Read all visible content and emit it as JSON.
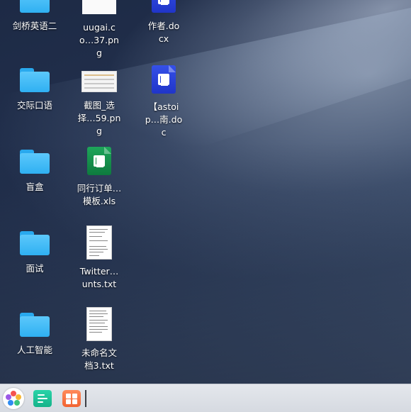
{
  "desktop": {
    "icons": [
      {
        "label": "剑桥英语二",
        "type": "folder"
      },
      {
        "label": "uugai.co…37.png",
        "type": "image"
      },
      {
        "label": "作者.docx",
        "type": "word"
      },
      {
        "label": "交际口语",
        "type": "folder"
      },
      {
        "label": "截图_选择…59.png",
        "type": "image"
      },
      {
        "label": "【astoip…南.doc",
        "type": "word"
      },
      {
        "label": "盲盒",
        "type": "folder"
      },
      {
        "label": "同行订单…模板.xls",
        "type": "excel"
      },
      {
        "label": "面试",
        "type": "folder"
      },
      {
        "label": "Twitter…unts.txt",
        "type": "text"
      },
      {
        "label": "人工智能",
        "type": "folder"
      },
      {
        "label": "未命名文档3.txt",
        "type": "text"
      }
    ]
  },
  "taskbar": {
    "apps": [
      {
        "name": "launcher-icon"
      },
      {
        "name": "terminal-icon"
      },
      {
        "name": "app-store-icon"
      }
    ]
  },
  "colors": {
    "folder": "#2fb0f2",
    "word": "#2035c8",
    "excel": "#139048",
    "taskbar": "#d6dae1"
  }
}
